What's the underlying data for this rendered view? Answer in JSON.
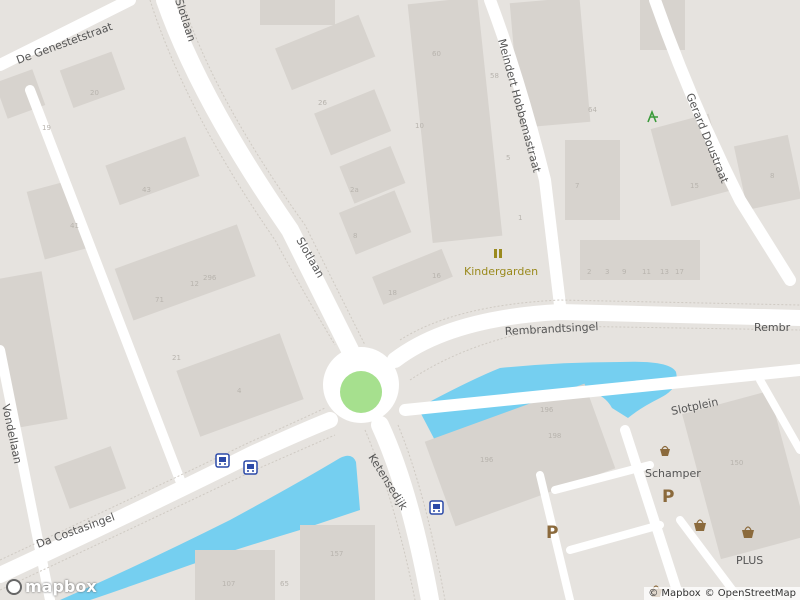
{
  "map": {
    "colors": {
      "land": "#e6e3df",
      "road": "#ffffff",
      "building": "#d7d3ce",
      "water": "#75cff0",
      "park": "#a6e08e",
      "poi_brown": "#8b6a3c",
      "poi_olive": "#9a8a1e",
      "transit": "#2c4aa8",
      "leisure_green": "#3a9a3a"
    },
    "streets": {
      "de_genestetstraat": "De Genestetstraat",
      "slotlaan_top": "Slotlaan",
      "slotlaan": "Slotlaan",
      "meindert_hobbemastraat": "Meindert Hobbemastraat",
      "gerard_doustraat": "Gerard Doustraat",
      "rembrandtsingel": "Rembrandtsingel",
      "rembrandtsingel_right": "Rembr",
      "slotplein": "Slotplein",
      "ketensedijk": "Ketensedijk",
      "da_costasingel": "Da Costasingel",
      "vondellaan": "Vondellaan"
    },
    "pois": {
      "kindergarden": "Kindergarden",
      "schamper": "Schamper",
      "plus": "PLUS"
    },
    "house_numbers": [
      "20",
      "19",
      "26",
      "10",
      "2a",
      "43",
      "41",
      "296",
      "71",
      "12",
      "8",
      "21",
      "4",
      "60",
      "58",
      "5",
      "16",
      "18",
      "1",
      "2",
      "3",
      "11",
      "17",
      "64",
      "7",
      "9",
      "13",
      "15",
      "8",
      "196",
      "198",
      "196",
      "150",
      "157",
      "107",
      "65"
    ],
    "icons": [
      "kindergarten-icon",
      "bus-stop-icon",
      "parking-icon",
      "shop-icon",
      "playground-icon"
    ]
  },
  "attribution": {
    "copyright_mapbox": "© Mapbox",
    "copyright_osm": "© OpenStreetMap",
    "logo_text": "mapbox"
  }
}
